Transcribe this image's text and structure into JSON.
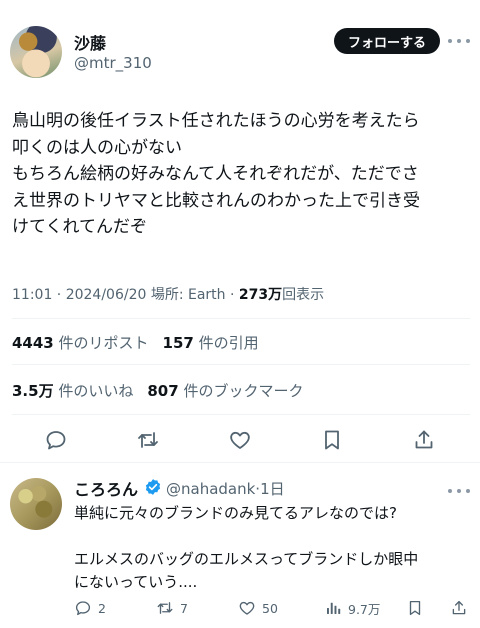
{
  "author": {
    "display_name": "沙藤",
    "handle": "@mtr_310",
    "follow_label": "フォローする"
  },
  "tweet": {
    "lines": [
      "鳥山明の後任イラスト任されたほうの心労を考えたら",
      "叩くのは人の心がない",
      "もちろん絵柄の好みなんて人それぞれだが、ただでさ",
      "え世界のトリヤマと比較されんのわかった上で引き受",
      "けてくれてんだぞ"
    ],
    "meta_prefix": "11:01 · 2024/06/20 場所: Earth · ",
    "views_count": "273万",
    "views_label": "回表示"
  },
  "stats": {
    "reposts_count": "4443",
    "reposts_label": "件のリポスト",
    "quotes_count": "157",
    "quotes_label": "件の引用",
    "likes_count": "3.5万",
    "likes_label": "件のいいね",
    "bookmarks_count": "807",
    "bookmarks_label": "件のブックマーク"
  },
  "reply": {
    "display_name": "ころろん",
    "handle_time": "@nahadank·1日",
    "lines": [
      "単純に元々のブランドのみ見てるアレなのでは?",
      "",
      "エルメスのバッグのエルメスってブランドしか眼中",
      "にないっていう...."
    ],
    "reply_count": "2",
    "repost_count": "7",
    "like_count": "50",
    "views_count": "9.7万"
  },
  "icons": {
    "action_bar": [
      "reply-icon",
      "repost-icon",
      "like-icon",
      "bookmark-icon",
      "share-icon"
    ],
    "verified": "verified-badge-icon",
    "more": "more-icon"
  },
  "colors": {
    "text": "#0f1419",
    "secondary": "#536471",
    "verified": "#1d9bf0",
    "follow_button": "#0f1419",
    "divider": "#eff3f4"
  }
}
